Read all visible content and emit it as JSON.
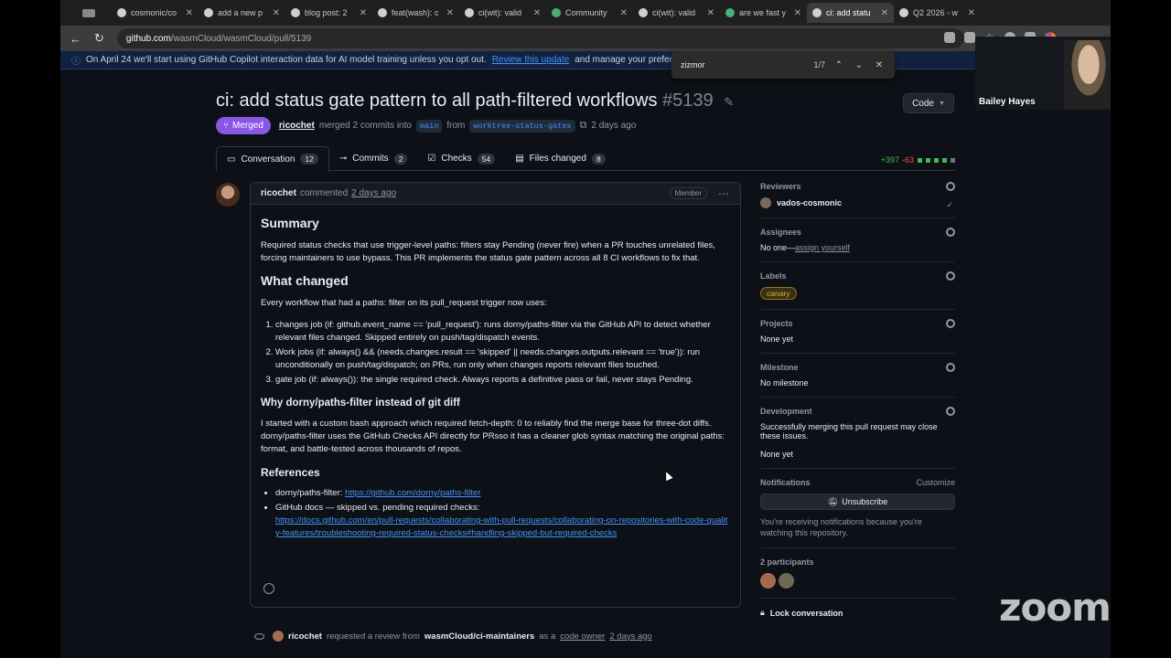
{
  "browser": {
    "tabs": [
      {
        "label": "",
        "active": false
      },
      {
        "label": "cosmonic/co",
        "active": false
      },
      {
        "label": "add a new p",
        "active": false
      },
      {
        "label": "blog post: 2",
        "active": false
      },
      {
        "label": "feat(wash): c",
        "active": false
      },
      {
        "label": "ci(wit): valid",
        "active": false
      },
      {
        "label": "Community",
        "active": false
      },
      {
        "label": "ci(wit): valid",
        "active": false
      },
      {
        "label": "are we fast y",
        "active": false
      },
      {
        "label": "ci: add statu",
        "active": true
      },
      {
        "label": "Q2 2026 - w",
        "active": false
      }
    ],
    "url_host": "github.com",
    "url_path": "/wasmCloud/wasmCloud/pull/5139"
  },
  "banner": {
    "text_before": "On April 24 we'll start using GitHub Copilot interaction data for AI model training unless you opt out.",
    "link": "Review this update",
    "text_after": "and manage your preferences"
  },
  "find": {
    "query": "zizmor",
    "count": "1/7"
  },
  "pr": {
    "title": "ci: add status gate pattern to all path-filtered workflows",
    "number": "#5139",
    "code_button": "Code",
    "state": "Merged",
    "author": "ricochet",
    "action": "merged 2 commits into",
    "base": "main",
    "from_word": "from",
    "head": "worktree-status-gates",
    "when": "2 days ago"
  },
  "tabs": [
    {
      "label": "Conversation",
      "count": "12"
    },
    {
      "label": "Commits",
      "count": "2"
    },
    {
      "label": "Checks",
      "count": "54"
    },
    {
      "label": "Files changed",
      "count": "8"
    }
  ],
  "diffstat": {
    "additions": "+397",
    "deletions": "-63"
  },
  "comment": {
    "author": "ricochet",
    "verb": "commented",
    "when": "2 days ago",
    "badge": "Member",
    "summary_heading": "Summary",
    "summary_text": "Required status checks that use trigger-level paths: filters stay Pending (never fire) when a PR touches unrelated files, forcing maintainers to use bypass. This PR implements the status gate pattern across all 8 CI workflows to fix that.",
    "changed_heading": "What changed",
    "changed_intro": "Every workflow that had a paths: filter on its pull_request trigger now uses:",
    "changed_items": [
      "changes job (if: github.event_name == 'pull_request'): runs dorny/paths-filter via the GitHub API to detect whether relevant files changed. Skipped entirely on push/tag/dispatch events.",
      "Work jobs (if: always() && (needs.changes.result == 'skipped' || needs.changes.outputs.relevant == 'true')): run unconditionally on push/tag/dispatch; on PRs, run only when changes reports relevant files touched.",
      "gate job (if: always()): the single required check. Always reports a definitive pass or fail, never stays Pending."
    ],
    "why_heading": "Why dorny/paths-filter instead of git diff",
    "why_text": "I started with a custom bash approach which required fetch-depth: 0 to reliably find the merge base for three-dot diffs. dorny/paths-filter uses the GitHub Checks API directly for PRsso it has a cleaner glob syntax matching the original paths: format, and battle-tested across thousands of repos.",
    "refs_heading": "References",
    "ref1_label": "dorny/paths-filter:",
    "ref1_link": "https://github.com/dorny/paths-filter",
    "ref2_label": "GitHub docs — skipped vs. pending required checks:",
    "ref2_link": "https://docs.github.com/en/pull-requests/collaborating-with-pull-requests/collaborating-on-repositories-with-code-quality-features/troubleshooting-required-status-checks#handling-skipped-but-required-checks"
  },
  "event": {
    "actor": "ricochet",
    "verb": "requested a review from",
    "team": "wasmCloud/ci-maintainers",
    "as": "as a",
    "role": "code owner",
    "when": "2 days ago"
  },
  "sidebar": {
    "reviewers_h": "Reviewers",
    "reviewer": "vados-cosmonic",
    "assignees_h": "Assignees",
    "assignees_none": "No one—",
    "assign_link": "assign yourself",
    "labels_h": "Labels",
    "label": "canary",
    "projects_h": "Projects",
    "projects_v": "None yet",
    "milestone_h": "Milestone",
    "milestone_v": "No milestone",
    "dev_h": "Development",
    "dev_text": "Successfully merging this pull request may close these issues.",
    "dev_v": "None yet",
    "notif_h": "Notifications",
    "customize": "Customize",
    "unsubscribe": "Unsubscribe",
    "notif_text": "You're receiving notifications because you're watching this repository.",
    "participants_h": "2 participants",
    "lock": "Lock conversation"
  },
  "zoom": {
    "participant": "Bailey Hayes",
    "logo": "zoom"
  }
}
